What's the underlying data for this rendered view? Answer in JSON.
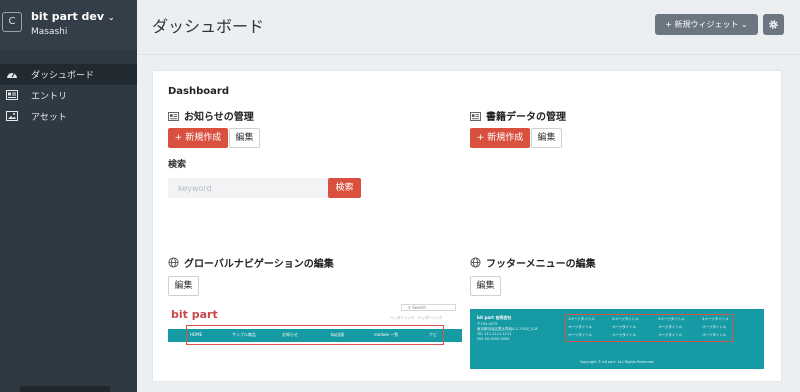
{
  "sidebar": {
    "logo_letter": "C",
    "site_name": "bit part dev",
    "user_name": "Masashi",
    "items": [
      {
        "label": "ダッシュボード",
        "icon": "dashboard-icon",
        "active": true
      },
      {
        "label": "エントリ",
        "icon": "entry-card-icon",
        "active": false
      },
      {
        "label": "アセット",
        "icon": "image-icon",
        "active": false
      }
    ]
  },
  "header": {
    "title": "ダッシュボード",
    "new_widget_label": "新規ウィジェット",
    "settings_icon": "gear-icon"
  },
  "panel": {
    "title": "Dashboard",
    "news": {
      "title": "お知らせの管理",
      "new_label": "新規作成",
      "edit_label": "編集",
      "search_label": "検索",
      "search_placeholder": "keyword",
      "search_button": "検索"
    },
    "books": {
      "title": "書籍データの管理",
      "new_label": "新規作成",
      "edit_label": "編集"
    },
    "global_nav": {
      "title": "グローバルナビゲーションの編集",
      "edit_label": "編集",
      "preview": {
        "logo": "bit part",
        "search_placeholder": "Search",
        "links": [
          "ヘッダーリンク",
          "ヘッダーリンク"
        ],
        "menu": [
          "HOME",
          "サンプル商品",
          "お知らせ",
          "bp出版",
          "module 一覧",
          "ナビ"
        ]
      }
    },
    "footer_menu": {
      "title": "フッターメニューの編集",
      "edit_label": "編集",
      "preview": {
        "company": "bit part 合同会社",
        "address": [
          "〒150-0075",
          "東京都渋谷区恵比寿南4-2-7 KSビル2F",
          "TEL 111-1111-1111",
          "FAX 00-0000-0000"
        ],
        "columns": [
          [
            "1ページタイトル",
            "ページタイトル",
            "ページタイトル"
          ],
          [
            "2ページタイトル",
            "ページタイトル",
            "ページタイトル"
          ],
          [
            "3ページタイトル",
            "ページタイトル",
            "ページタイトル"
          ],
          [
            "4ページタイトル",
            "ページタイトル",
            "ページタイトル"
          ]
        ],
        "copyright": "Copyright © bit part. ALL Rights Reserved."
      }
    }
  },
  "colors": {
    "sidebar_bg": "#2f3942",
    "accent_red": "#d9503f",
    "preview_teal": "#169aa3",
    "header_button": "#6b7680"
  }
}
